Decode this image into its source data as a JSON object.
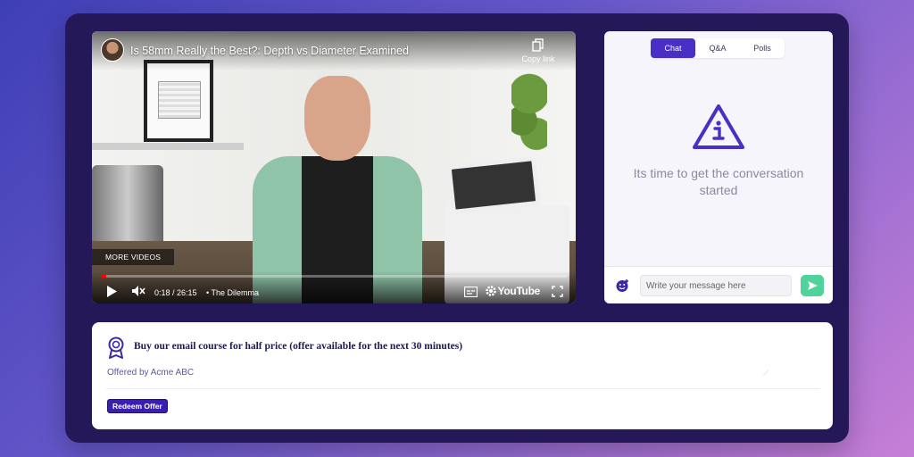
{
  "video": {
    "title": "Is 58mm Really the Best?: Depth vs Diameter Examined",
    "copy_link_label": "Copy link",
    "more_videos_label": "MORE VIDEOS",
    "time": "0:18 / 26:15",
    "chapter": "• The Dilemma",
    "brand": "YouTube",
    "progress": 0.011,
    "icons": [
      "play-icon",
      "mute-icon",
      "captions-icon",
      "settings-icon",
      "fullscreen-icon",
      "copy-icon"
    ]
  },
  "chat": {
    "tabs": [
      {
        "label": "Chat"
      },
      {
        "label": "Q&A"
      },
      {
        "label": "Polls"
      }
    ],
    "empty_message": "Its time to get the conversation started",
    "input_placeholder": "Write your message here",
    "accent": "#4a2fc6",
    "send_color": "#4fd39a"
  },
  "offer": {
    "title": "Buy our email course for half price (offer available for the next 30 minutes)",
    "offered_by": "Offered by Acme ABC",
    "redeem_label": "Redeem Offer",
    "accent": "#3a1fb0"
  }
}
